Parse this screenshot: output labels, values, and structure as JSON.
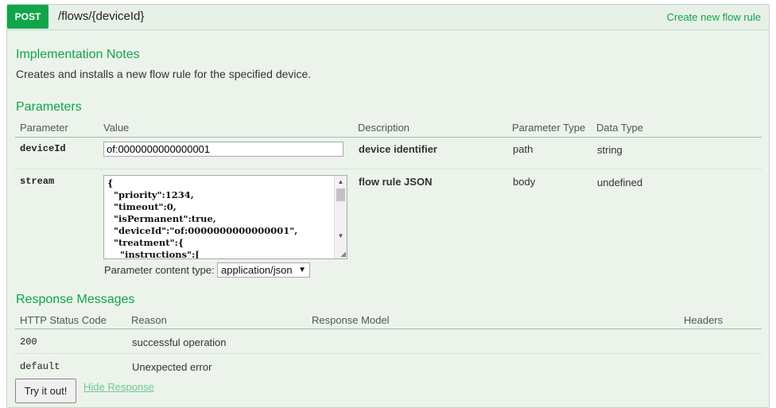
{
  "operation": {
    "method": "POST",
    "path": "/flows/{deviceId}",
    "summary": "Create new flow rule"
  },
  "notes": {
    "title": "Implementation Notes",
    "text": "Creates and installs a new flow rule for the specified device."
  },
  "parameters": {
    "title": "Parameters",
    "headers": [
      "Parameter",
      "Value",
      "Description",
      "Parameter Type",
      "Data Type"
    ],
    "rows": [
      {
        "name": "deviceId",
        "value": "of:0000000000000001",
        "description": "device identifier",
        "param_type": "path",
        "data_type": "string"
      },
      {
        "name": "stream",
        "value": "{\n  \"priority\":1234,\n  \"timeout\":0,\n  \"isPermanent\":true,\n  \"deviceId\":\"of:0000000000000001\",\n  \"treatment\":{\n    \"instructions\":[",
        "description": "flow rule JSON",
        "param_type": "body",
        "data_type": "undefined"
      }
    ],
    "content_type_label": "Parameter content type:",
    "content_type_value": "application/json"
  },
  "responses": {
    "title": "Response Messages",
    "headers": [
      "HTTP Status Code",
      "Reason",
      "Response Model",
      "Headers"
    ],
    "rows": [
      {
        "code": "200",
        "reason": "successful operation"
      },
      {
        "code": "default",
        "reason": "Unexpected error"
      }
    ]
  },
  "actions": {
    "try_label": "Try it out!",
    "hide_label": "Hide Response"
  },
  "colors": {
    "accent": "#10a54a",
    "panel_bg": "#ebf3eb",
    "link": "#6fc992"
  }
}
